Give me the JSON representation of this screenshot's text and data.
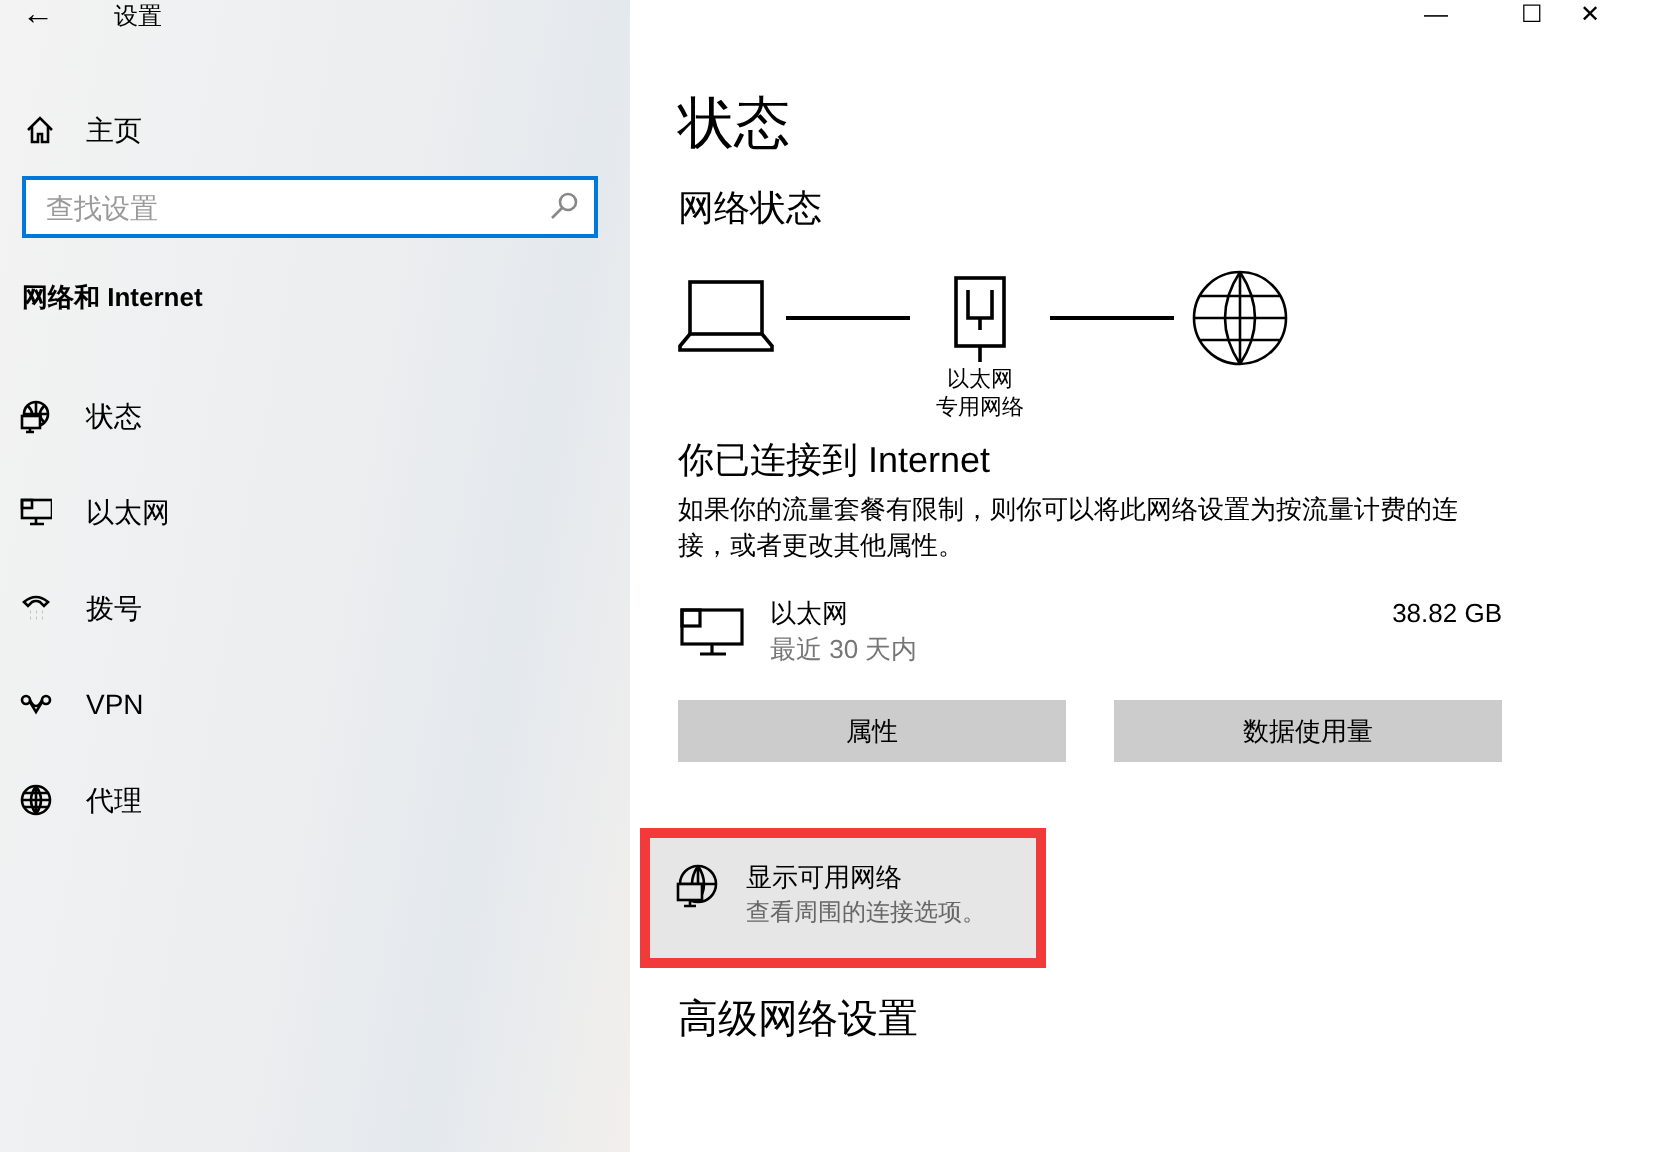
{
  "window": {
    "title": "设置",
    "back": "←",
    "controls": [
      "—",
      "☐",
      "✕"
    ]
  },
  "sidebar": {
    "home": "主页",
    "search": {
      "placeholder": "查找设置"
    },
    "section": "网络和 Internet",
    "items": [
      {
        "label": "状态",
        "kind": "status"
      },
      {
        "label": "以太网",
        "kind": "ethernet"
      },
      {
        "label": "拨号",
        "kind": "dialup"
      },
      {
        "label": "VPN",
        "kind": "vpn"
      },
      {
        "label": "代理",
        "kind": "proxy"
      }
    ]
  },
  "main": {
    "title": "状态",
    "network_heading": "网络状态",
    "diagram": {
      "adapter": "以太网",
      "profile": "专用网络"
    },
    "connected": "你已连接到 Internet",
    "description": "如果你的流量套餐有限制，则你可以将此网络设置为按流量计费的连接，或者更改其他属性。",
    "connection": {
      "name": "以太网",
      "period": "最近 30 天内",
      "usage": "38.82 GB"
    },
    "buttons": [
      "属性",
      "数据使用量"
    ],
    "show_networks": {
      "title": "显示可用网络",
      "subtitle": "查看周围的连接选项。",
      "highlighted": true
    },
    "advanced": "高级网络设置"
  }
}
